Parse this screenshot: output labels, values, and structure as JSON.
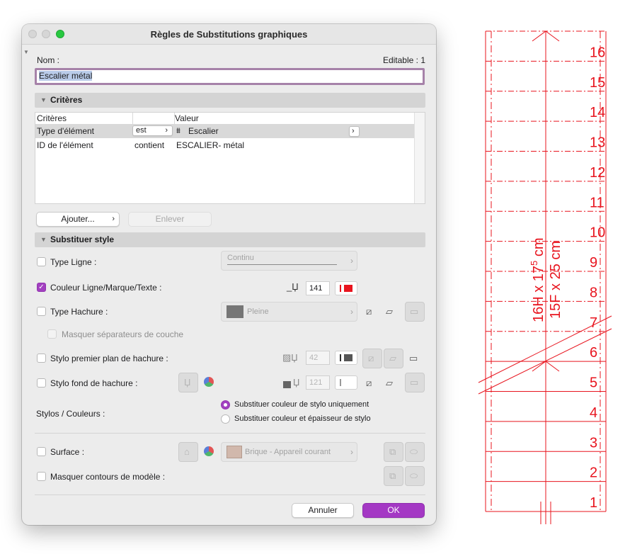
{
  "window": {
    "title": "Règles de Substitutions graphiques"
  },
  "name_row": {
    "label": "Nom :",
    "editable": "Editable : 1",
    "value": "Escalier métal"
  },
  "criteria": {
    "section_title": "Critères",
    "col_criteria": "Critères",
    "col_value": "Valeur",
    "rows": [
      {
        "criterion": "Type d'élément",
        "operator": "est",
        "value": "Escalier"
      },
      {
        "criterion": "ID de l'élément",
        "operator": "contient",
        "value": "ESCALIER- métal"
      }
    ],
    "add_button": "Ajouter...",
    "remove_button": "Enlever"
  },
  "override": {
    "section_title": "Substituer style",
    "line_type": {
      "label": "Type Ligne :",
      "value": "Continu",
      "checked": false
    },
    "line_color": {
      "label": "Couleur Ligne/Marque/Texte :",
      "pen": "141",
      "checked": true
    },
    "fill_type": {
      "label": "Type Hachure :",
      "value": "Pleine",
      "checked": false
    },
    "hide_separators": {
      "label": "Masquer séparateurs de couche"
    },
    "fill_fg_pen": {
      "label": "Stylo premier plan de hachure :",
      "pen": "42",
      "checked": false
    },
    "fill_bg_pen": {
      "label": "Stylo fond de hachure :",
      "pen": "121",
      "checked": false
    },
    "pens_colors": {
      "label": "Stylos / Couleurs :",
      "option1": "Substituer couleur de stylo uniquement",
      "option2": "Substituer couleur et épaisseur de stylo",
      "selected": 1
    },
    "surface": {
      "label": "Surface :",
      "value": "Brique - Appareil courant",
      "checked": false
    },
    "hide_contours": {
      "label": "Masquer contours de modèle :",
      "checked": false
    }
  },
  "buttons": {
    "cancel": "Annuler",
    "ok": "OK"
  },
  "colors": {
    "accent": "#a438c4",
    "drawing": "#e8141e",
    "pen_swatch": "#e8141e"
  },
  "drawing": {
    "step_numbers": [
      "16",
      "15",
      "14",
      "13",
      "12",
      "11",
      "10",
      "9",
      "8",
      "7",
      "6",
      "5",
      "4",
      "3",
      "2",
      "1"
    ],
    "dimension_line1": "16H x 17",
    "dimension_line1_sup": "5",
    "dimension_line1_unit": " cm",
    "dimension_line2": "15F x 25 cm"
  }
}
